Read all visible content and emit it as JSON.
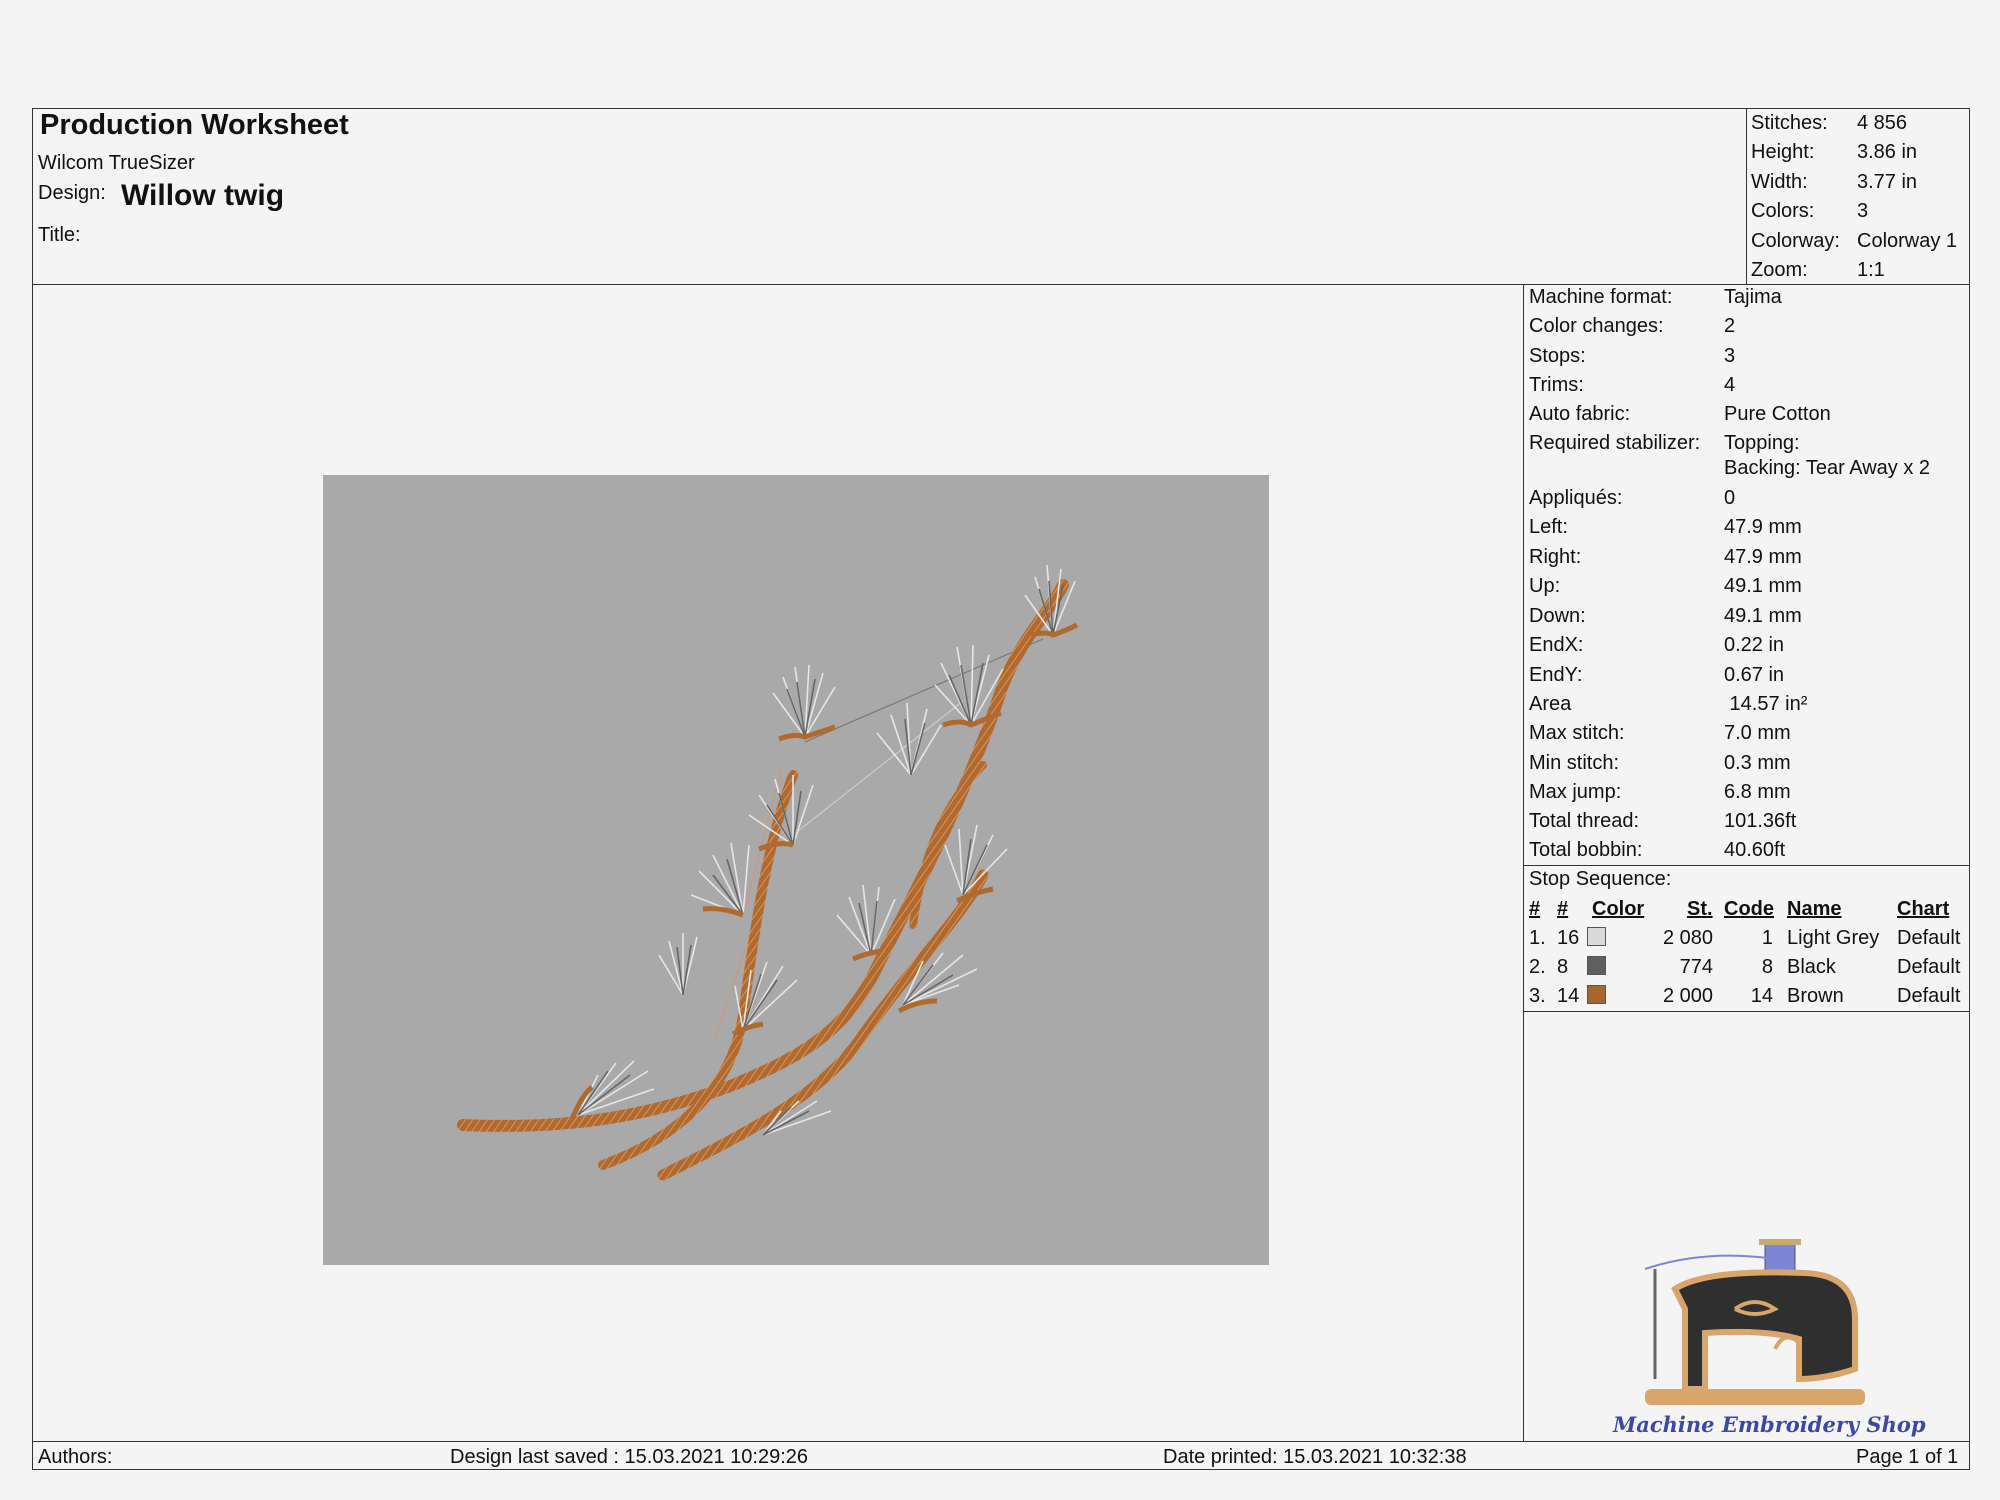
{
  "header": {
    "title": "Production Worksheet",
    "app": "Wilcom TrueSizer",
    "design_label": "Design:",
    "design_name": "Willow twig",
    "title_label": "Title:"
  },
  "summary": [
    {
      "label": "Stitches:",
      "value": "4 856"
    },
    {
      "label": "Height:",
      "value": "3.86 in"
    },
    {
      "label": "Width:",
      "value": "3.77 in"
    },
    {
      "label": "Colors:",
      "value": "3"
    },
    {
      "label": "Colorway:",
      "value": "Colorway 1"
    },
    {
      "label": "Zoom:",
      "value": "1:1"
    }
  ],
  "details": [
    {
      "label": "Machine format:",
      "value": "Tajima"
    },
    {
      "label": "Color changes:",
      "value": "2"
    },
    {
      "label": "Stops:",
      "value": "3"
    },
    {
      "label": "Trims:",
      "value": "4"
    },
    {
      "label": "Auto fabric:",
      "value": "Pure Cotton"
    },
    {
      "label": "Required stabilizer:",
      "value": "Topping:",
      "value2": "Backing: Tear Away x 2"
    },
    {
      "label": "Appliqués:",
      "value": "0"
    },
    {
      "label": "Left:",
      "value": "47.9 mm"
    },
    {
      "label": "Right:",
      "value": "47.9 mm"
    },
    {
      "label": "Up:",
      "value": "49.1 mm"
    },
    {
      "label": "Down:",
      "value": "49.1 mm"
    },
    {
      "label": "EndX:",
      "value": "0.22 in"
    },
    {
      "label": "EndY:",
      "value": "0.67 in"
    },
    {
      "label": "Area",
      "value": " 14.57 in²"
    },
    {
      "label": "Max stitch:",
      "value": "7.0 mm"
    },
    {
      "label": "Min stitch:",
      "value": "0.3 mm"
    },
    {
      "label": "Max jump:",
      "value": "6.8 mm"
    },
    {
      "label": "Total thread:",
      "value": "101.36ft"
    },
    {
      "label": "Total bobbin:",
      "value": "40.60ft"
    }
  ],
  "stop_sequence": {
    "label": "Stop Sequence:",
    "headers": {
      "n1": "#",
      "n2": "#",
      "color": "Color",
      "st": "St.",
      "code": "Code",
      "name": "Name",
      "chart": "Chart"
    },
    "rows": [
      {
        "idx": "1.",
        "num": "16",
        "color": "#d9d9d9",
        "st": "2 080",
        "code": "1",
        "name": "Light Grey",
        "chart": "Default"
      },
      {
        "idx": "2.",
        "num": "8",
        "color": "#5f5f5f",
        "st": "774",
        "code": "8",
        "name": "Black",
        "chart": "Default"
      },
      {
        "idx": "3.",
        "num": "14",
        "color": "#a8652e",
        "st": "2 000",
        "code": "14",
        "name": "Brown",
        "chart": "Default"
      }
    ]
  },
  "footer": {
    "authors": "Authors:",
    "saved": "Design last saved : 15.03.2021 10:29:26",
    "printed": "Date printed: 15.03.2021 10:32:38",
    "page": "Page 1 of 1"
  },
  "logo": {
    "text": "Machine Embroidery Shop"
  },
  "colors": {
    "background": "#f4f4f4",
    "preview_bg": "#a9a9a9",
    "thread_brown": "#b06a30",
    "thread_grey": "#dcdcdc"
  }
}
